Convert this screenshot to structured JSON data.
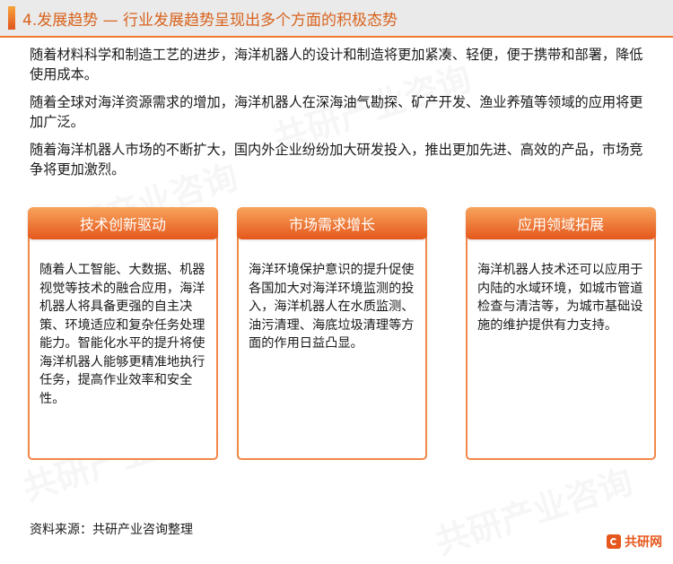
{
  "title": "4.发展趋势 — 行业发展趋势呈现出多个方面的积极态势",
  "intro": [
    "随着材料科学和制造工艺的进步，海洋机器人的设计和制造将更加紧凑、轻便，便于携带和部署，降低使用成本。",
    "随着全球对海洋资源需求的增加，海洋机器人在深海油气勘探、矿产开发、渔业养殖等领域的应用将更加广泛。",
    "随着海洋机器人市场的不断扩大，国内外企业纷纷加大研发投入，推出更加先进、高效的产品，市场竞争将更加激烈。"
  ],
  "cards": [
    {
      "title": "技术创新驱动",
      "body": "随着人工智能、大数据、机器视觉等技术的融合应用，海洋机器人将具备更强的自主决策、环境适应和复杂任务处理能力。智能化水平的提升将使海洋机器人能够更精准地执行任务，提高作业效率和安全性。"
    },
    {
      "title": "市场需求增长",
      "body": "海洋环境保护意识的提升促使各国加大对海洋环境监测的投入，海洋机器人在水质监测、油污清理、海底垃圾清理等方面的作用日益凸显。"
    },
    {
      "title": "应用领域拓展",
      "body": "海洋机器人技术还可以应用于内陆的水域环境，如城市管道检查与清洁等，为城市基础设施的维护提供有力支持。"
    }
  ],
  "source": "资料来源：共研产业咨询整理",
  "brand": {
    "text": "共研网",
    "icon": "brand-logo-icon"
  },
  "watermark": "共研产业咨询",
  "colors": {
    "accent": "#e5571c",
    "title_text": "#d8631d",
    "border": "#f2874a"
  }
}
